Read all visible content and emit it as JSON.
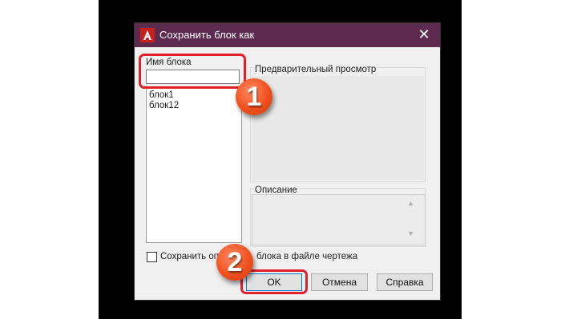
{
  "dialog": {
    "title": "Сохранить блок как",
    "close_glyph": "✕",
    "icon_name": "autocad-icon"
  },
  "block_name": {
    "label": "Имя блока",
    "value": "",
    "items": [
      "блок1",
      "блок12"
    ]
  },
  "preview": {
    "label": "Предварительный просмотр"
  },
  "description": {
    "label": "Описание"
  },
  "save_checkbox": {
    "label_left": "Сохранить опр",
    "label_right": "блока в файле чертежа",
    "checked": false
  },
  "buttons": {
    "ok": "OK",
    "cancel": "Отмена",
    "help": "Справка"
  },
  "annotations": {
    "step1": "1",
    "step2": "2",
    "highlight_color": "#e3202a",
    "badge_color": "#f0501e"
  },
  "colors": {
    "titlebar": "#5d2b50",
    "dialog_bg": "#f0f0f0"
  }
}
